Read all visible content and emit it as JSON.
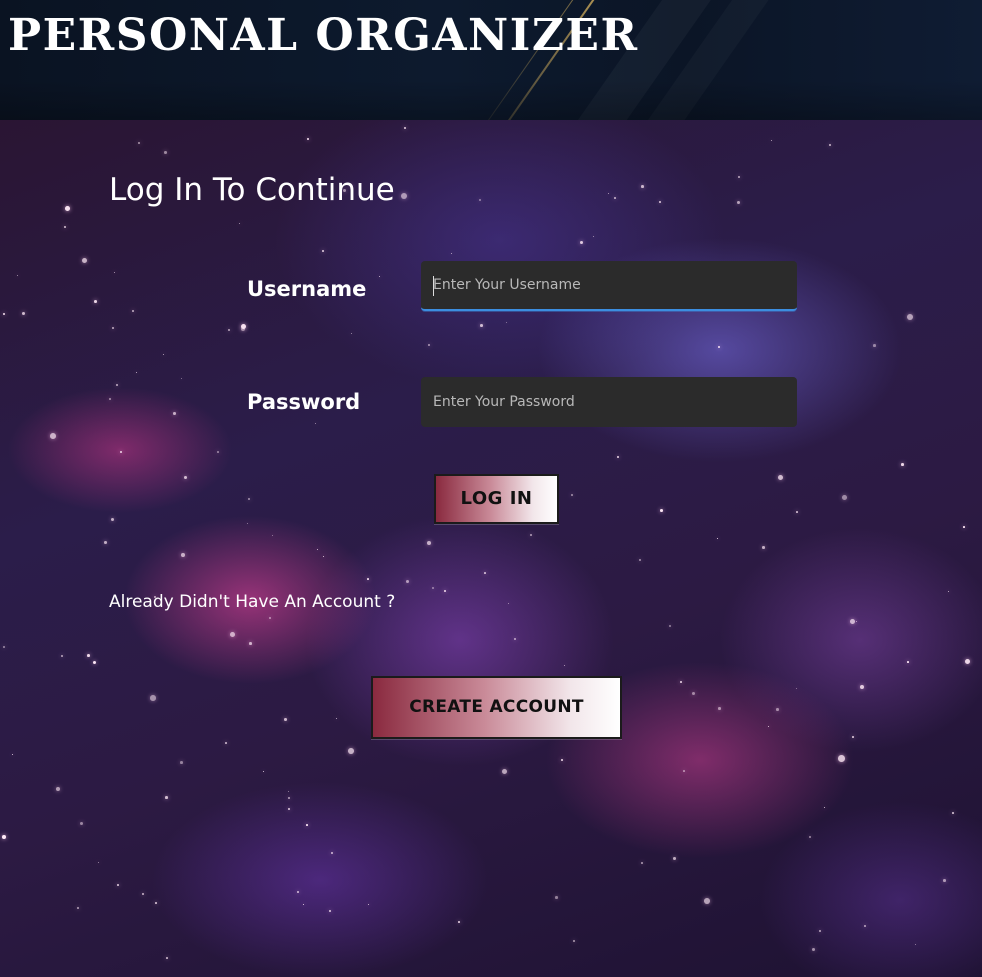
{
  "header": {
    "app_title": "PERSONAL ORGANIZER"
  },
  "login": {
    "heading": "Log In To Continue",
    "username_label": "Username",
    "username_placeholder": "Enter Your Username",
    "password_label": "Password",
    "password_placeholder": "Enter Your Password",
    "login_button": "LOG IN"
  },
  "signup": {
    "prompt": "Already Didn't Have An Account ?",
    "create_button": "CREATE ACCOUNT"
  },
  "colors": {
    "header_bg": "#0d1a2e",
    "input_bg": "#2b2b2b",
    "focus_accent": "#3c8ee0",
    "button_gradient_start": "#8a2a3f",
    "button_gradient_end": "#ffffff"
  }
}
